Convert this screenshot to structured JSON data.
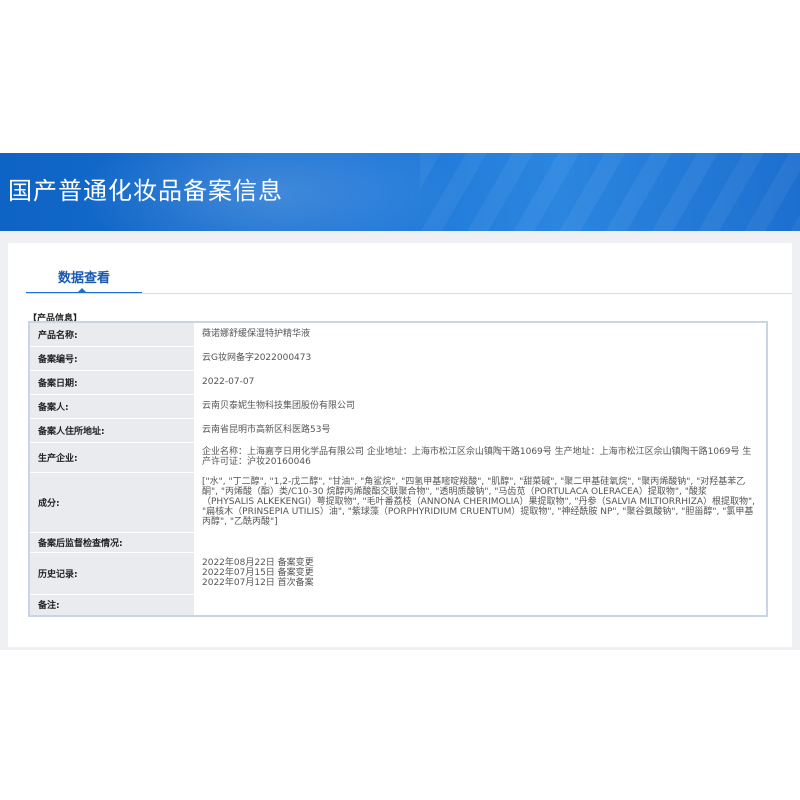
{
  "page_title": "国产普通化妆品备案信息",
  "tab_label": "数据查看",
  "section_label": "【产品信息】",
  "rows": [
    {
      "key": "产品名称:",
      "value": "薇诺娜舒缓保湿特护精华液"
    },
    {
      "key": "备案编号:",
      "value": "云G妆网备字2022000473"
    },
    {
      "key": "备案日期:",
      "value": "2022-07-07"
    },
    {
      "key": "备案人:",
      "value": "云南贝泰妮生物科技集团股份有限公司"
    },
    {
      "key": "备案人住所地址:",
      "value": "云南省昆明市高新区科医路53号"
    },
    {
      "key": "生产企业:",
      "value": "企业名称：上海嘉亨日用化学品有限公司 企业地址：上海市松江区佘山镇陶干路1069号 生产地址：上海市松江区佘山镇陶干路1069号 生产许可证：沪妆20160046"
    },
    {
      "key": "成分:",
      "value": "[\"水\", \"丁二醇\", \"1,2-戊二醇\", \"甘油\", \"角鲨烷\", \"四氢甲基嘧啶羧酸\", \"肌醇\", \"甜菜碱\", \"聚二甲基硅氧烷\", \"聚丙烯酸钠\", \"对羟基苯乙酮\", \"丙烯酸（酯）类/C10-30 烷醇丙烯酸酯交联聚合物\", \"透明质酸钠\", \"马齿苋（PORTULACA OLERACEA）提取物\", \"酸浆（PHYSALIS ALKEKENGI）萼提取物\", \"毛叶番荔枝（ANNONA CHERIMOLIA）果提取物\", \"丹参（SALVIA MILTIORRHIZA）根提取物\", \"扁核木（PRINSEPIA UTILIS）油\", \"紫球藻（PORPHYRIDIUM CRUENTUM）提取物\", \"神经酰胺 NP\", \"聚谷氨酸钠\", \"胆甾醇\", \"氯甲基丙醇\", \"乙酰丙酸\"]"
    },
    {
      "key": "备案后监督检查情况:",
      "value": ""
    },
    {
      "key": "历史记录:",
      "history": [
        "2022年08月22日 备案变更",
        "2022年07月15日 备案变更",
        "2022年07月12日 首次备案"
      ]
    },
    {
      "key": "备注:",
      "value": ""
    }
  ]
}
